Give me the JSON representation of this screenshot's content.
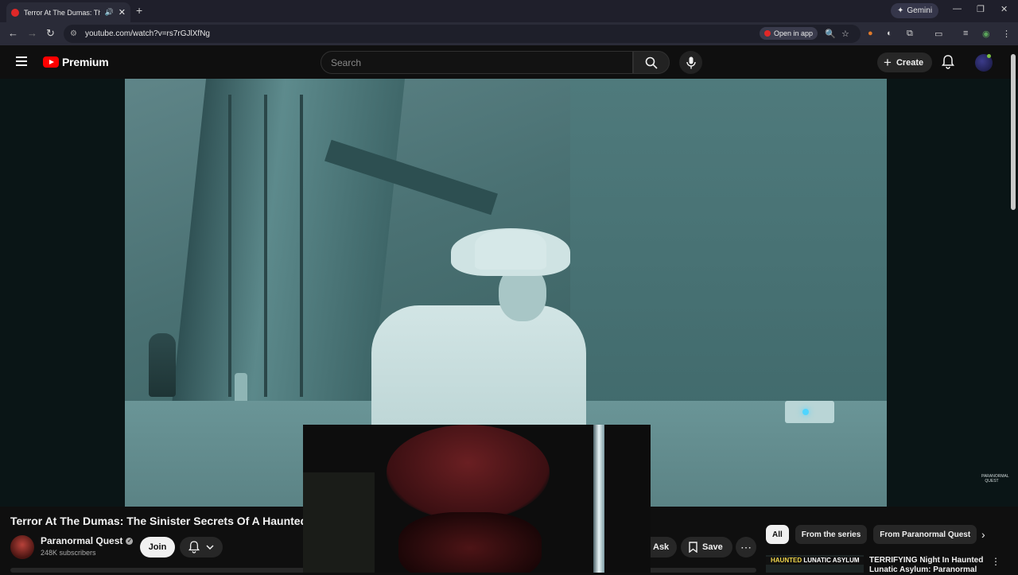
{
  "browser": {
    "tab_title": "Terror At The Dumas: The Sinister Secrets Of A Haunted",
    "tab_sound_icon": "speaker-icon",
    "new_tab": "+",
    "gemini_label": "Gemini",
    "url": "youtube.com/watch?v=rs7rGJlXfNg",
    "open_in_app": "Open in app"
  },
  "youtube": {
    "logo_text": "Premium",
    "search_placeholder": "Search",
    "create_label": "Create"
  },
  "video": {
    "title": "Terror At The Dumas: The Sinister Secrets Of A Haunted",
    "channel_name": "Paranormal Quest",
    "subscribers": "248K subscribers",
    "join_label": "Join",
    "ask_label": "Ask",
    "save_label": "Save",
    "watermark": "PARANORMAL QUEST"
  },
  "sidebar": {
    "chips": [
      "All",
      "From the series",
      "From Paranormal Quest"
    ],
    "recommendation": {
      "thumb_text_1": "HAUNTED",
      "thumb_text_2": "LUNATIC ASYLUM",
      "title": "TERRIFYING Night In Haunted Lunatic Asylum: Paranormal"
    }
  },
  "colors": {
    "brand_red": "#ff0000",
    "background": "#0f0f0f",
    "chip_bg": "#272727"
  }
}
